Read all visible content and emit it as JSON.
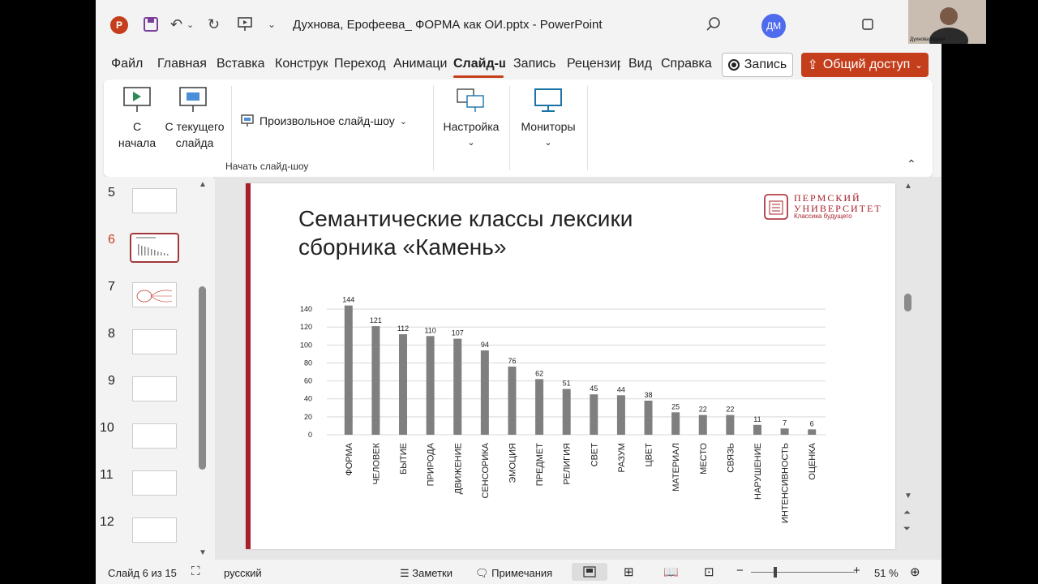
{
  "titlebar": {
    "app_logo": "P",
    "doc_title": "Духнова, Ерофеева_ ФОРМА как ОИ.pptx  -  PowerPoint",
    "avatar_initials": "ДМ"
  },
  "tabs": [
    {
      "label": "Файл"
    },
    {
      "label": "Главная"
    },
    {
      "label": "Вставка"
    },
    {
      "label": "Конструктор"
    },
    {
      "label": "Переходы"
    },
    {
      "label": "Анимация"
    },
    {
      "label": "Слайд-шоу"
    },
    {
      "label": "Запись"
    },
    {
      "label": "Рецензирование"
    },
    {
      "label": "Вид"
    },
    {
      "label": "Справка"
    }
  ],
  "record_label": "Запись",
  "share_label": "Общий доступ",
  "ribbon": {
    "from_start": "С\nначала",
    "from_current": "С текущего\nслайда",
    "custom_show": "Произвольное слайд-шоу",
    "setup": "Настройка",
    "monitors": "Мониторы",
    "group_label": "Начать слайд-шоу"
  },
  "thumbnails": [
    "5",
    "6",
    "7",
    "8",
    "9",
    "10",
    "11",
    "12"
  ],
  "slide": {
    "title": "Семантические классы лексики сборника «Камень»",
    "logo_line1": "ПЕРМСКИЙ",
    "logo_line2": "УНИВЕРСИТЕТ",
    "logo_tagline": "Классика будущего"
  },
  "chart_data": {
    "type": "bar",
    "categories": [
      "ФОРМА",
      "ЧЕЛОВЕК",
      "БЫТИЕ",
      "ПРИРОДА",
      "ДВИЖЕНИЕ",
      "СЕНСОРИКА",
      "ЭМОЦИЯ",
      "ПРЕДМЕТ",
      "РЕЛИГИЯ",
      "СВЕТ",
      "РАЗУМ",
      "ЦВЕТ",
      "МАТЕРИАЛ",
      "МЕСТО",
      "СВЯЗЬ",
      "НАРУШЕНИЕ",
      "ИНТЕНСИВНОСТЬ",
      "ОЦЕНКА"
    ],
    "values": [
      144,
      121,
      112,
      110,
      107,
      94,
      76,
      62,
      51,
      45,
      44,
      38,
      25,
      22,
      22,
      11,
      7,
      6
    ],
    "yticks": [
      "0",
      "20",
      "40",
      "60",
      "80",
      "100",
      "120",
      "140"
    ],
    "ylim": [
      0,
      150
    ],
    "bar_color": "#7f7f7f",
    "grid": true
  },
  "status": {
    "slide_counter": "Слайд 6 из 15",
    "language": "русский",
    "notes": "Заметки",
    "comments": "Примечания",
    "zoom": "51 %"
  },
  "webcam_name": "Духнова Мария",
  "colors": {
    "accent": "#c43e1c",
    "slide_bar": "#a8202a"
  }
}
